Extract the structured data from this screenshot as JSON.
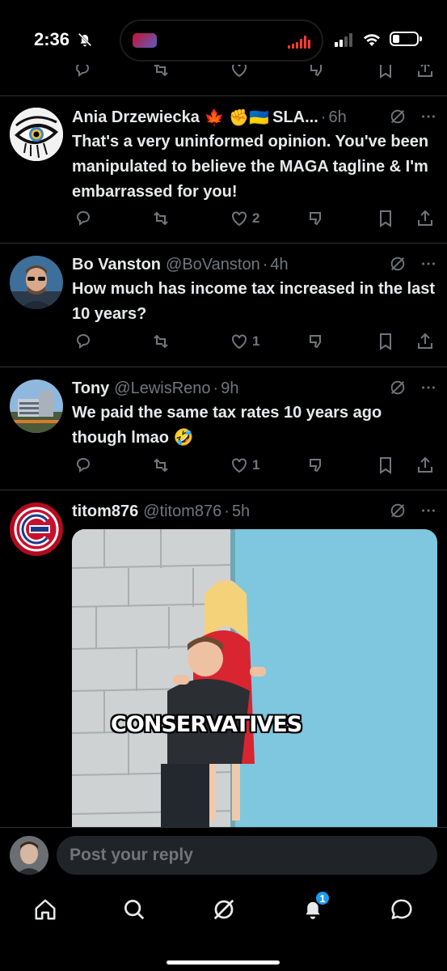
{
  "status_bar": {
    "time": "2:36",
    "icons": [
      "bell-off-icon",
      "signal-icon",
      "wifi-icon",
      "battery-icon"
    ]
  },
  "tweets": [
    {
      "name": "Ania Drzewiecka",
      "name_emoji": "🍁 ✊🇺🇦",
      "name_suffix": "SLA...",
      "handle": "",
      "time": "6h",
      "text": "That's a very uninformed opinion.  You've been manipulated to believe the MAGA tagline & I'm embarrassed for you!",
      "likes": "2"
    },
    {
      "name": "Bo Vanston",
      "handle": "@BoVanston",
      "time": "4h",
      "text": "How much has income tax increased in the last 10 years?",
      "likes": "1"
    },
    {
      "name": "Tony",
      "handle": "@LewisReno",
      "time": "9h",
      "text": "We paid the same tax rates 10 years ago though lmao 🤣",
      "likes": "1"
    },
    {
      "name": "titom876",
      "handle": "@titom876",
      "time": "5h",
      "meme_caption": "CONSERVATIVES"
    }
  ],
  "separator": "·",
  "reply": {
    "placeholder": "Post your reply"
  },
  "bottom_nav": {
    "items": [
      "home-icon",
      "search-icon",
      "grok-icon",
      "notifications-icon",
      "messages-icon"
    ],
    "notification_count": "1"
  },
  "colors": {
    "background": "#000000",
    "text": "#e7e9ea",
    "muted": "#71767b",
    "divider": "#2f3336",
    "accent": "#1d9bf0"
  }
}
